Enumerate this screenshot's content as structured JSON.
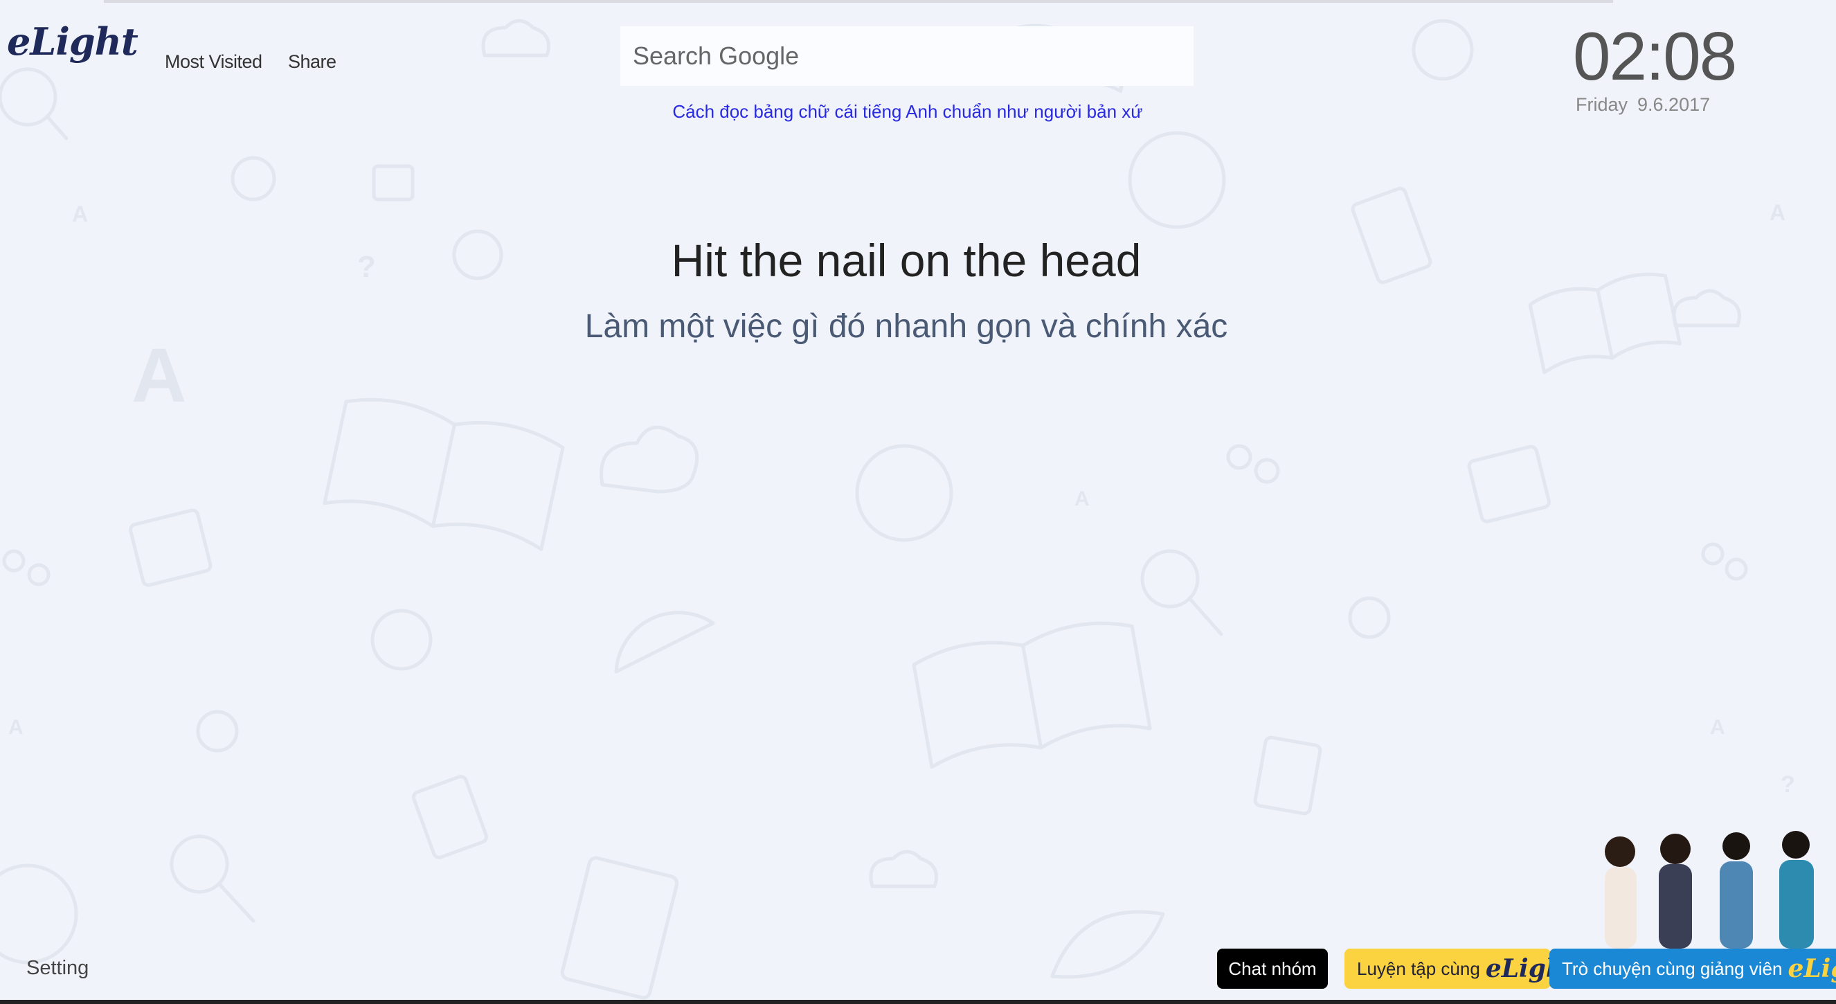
{
  "header": {
    "logo_text": "eLight",
    "nav": {
      "most_visited": "Most Visited",
      "share": "Share"
    }
  },
  "search": {
    "placeholder": "Search Google",
    "value": ""
  },
  "tip_link": "Cách đọc bảng chữ cái tiếng Anh chuẩn như người bản xứ",
  "clock": {
    "time": "02:08",
    "weekday": "Friday",
    "date": "9.6.2017"
  },
  "idiom": {
    "phrase": "Hit the nail on the head",
    "meaning": "Làm một việc gì đó nhanh gọn và chính xác"
  },
  "footer": {
    "setting": "Setting",
    "chat_group": "Chat nhóm",
    "practice": "Luyện tập cùng",
    "practice_logo": "eLight",
    "teacher": "Trò chuyện cùng giảng viên",
    "teacher_logo": "eLight"
  },
  "colors": {
    "background": "#f0f3fa",
    "logo": "#1f2a5a",
    "link": "#2929e0",
    "practice_button": "#fbd341",
    "teacher_button": "#1b88d6",
    "chat_button": "#000000"
  },
  "icons": [
    "book-icon",
    "globe-icon",
    "gear-icon",
    "cloud-icon",
    "magnifier-icon",
    "folder-icon",
    "laptop-icon",
    "alarm-clock-icon",
    "protractor-icon",
    "leaf-icon",
    "glasses-icon"
  ]
}
